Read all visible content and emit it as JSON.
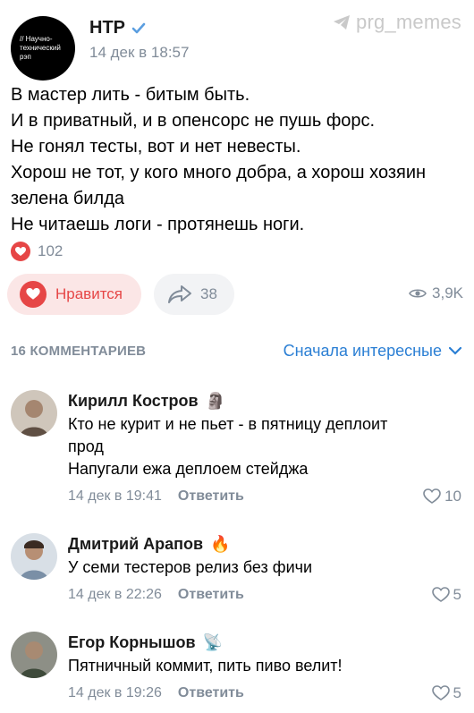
{
  "watermark": "prg_memes",
  "post": {
    "channel_avatar_lines": [
      "// Научно-",
      "технический",
      "рэп"
    ],
    "author": "НТР",
    "date": "14 дек в 18:57",
    "lines": [
      "В мастер лить - битым быть.",
      "И в приватный, и в опенсорс не пушь форс.",
      "Не гонял тесты, вот и нет невесты.",
      "Хорош не тот, у кого много добра, а хорош хозяин",
      "зелена билда",
      "Не читаешь логи - протянешь ноги."
    ],
    "reaction_count": "102",
    "like_label": "Нравится",
    "share_count": "38",
    "views": "3,9K"
  },
  "comments_header": {
    "count_label": "16 КОММЕНТАРИЕВ",
    "sort_label": "Сначала интересные"
  },
  "comments": [
    {
      "name": "Кирилл Костров",
      "emoji": "🗿",
      "text_lines": [
        "Кто не курит и не пьет - в пятницу деплоит",
        "прод",
        "Напугали ежа деплоем стейджа"
      ],
      "date": "14 дек в 19:41",
      "reply_label": "Ответить",
      "likes": "10"
    },
    {
      "name": "Дмитрий Арапов",
      "emoji": "🔥",
      "text_lines": [
        "У семи тестеров релиз без фичи"
      ],
      "date": "14 дек в 22:26",
      "reply_label": "Ответить",
      "likes": "5"
    },
    {
      "name": "Егор Корнышов",
      "emoji": "📡",
      "text_lines": [
        "Пятничный коммит, пить пиво велит!"
      ],
      "date": "14 дек в 19:26",
      "reply_label": "Ответить",
      "likes": "5"
    }
  ],
  "colors": {
    "accent": "#2b7fd4",
    "like": "#e64646",
    "muted": "#818c99"
  }
}
